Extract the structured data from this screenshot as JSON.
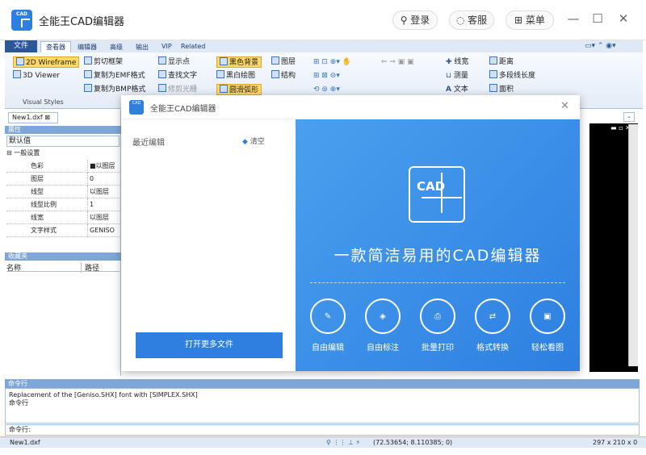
{
  "app": {
    "title": "全能王CAD编辑器",
    "login": "登录",
    "service": "客服",
    "menu": "菜单"
  },
  "ribbon": {
    "tabs": {
      "file": "文件",
      "viewer": "查看器",
      "editor": "编辑器",
      "advanced": "高级",
      "output": "输出",
      "vip": "VIP",
      "related": "Related"
    },
    "wireframe2d": "2D Wireframe",
    "viewer3d": "3D Viewer",
    "visual_styles": "Visual Styles",
    "trim_frame": "剪切框架",
    "copy_emf": "复制为EMF格式",
    "copy_bmp": "复制为BMP格式",
    "show_points": "显示点",
    "find_text": "查找文字",
    "fix_raster": "修剪光栅",
    "black_bg": "黑色背景",
    "bw_draw": "黑白绘图",
    "smooth_arc": "圆滑弧形",
    "layers": "图层",
    "structure": "结构",
    "line_width": "线宽",
    "measure": "测量",
    "text": "文本",
    "distance": "距离",
    "polyline_len": "多段线长度",
    "area": "面积"
  },
  "left": {
    "doc_tab": "New1.dxf",
    "props_header": "属性",
    "default_value": "默认值",
    "general": "一般设置",
    "rows": [
      {
        "k": "色彩",
        "v": "■以图层"
      },
      {
        "k": "图层",
        "v": "0"
      },
      {
        "k": "线型",
        "v": "以图层"
      },
      {
        "k": "线型比例",
        "v": "1"
      },
      {
        "k": "线宽",
        "v": "以图层"
      },
      {
        "k": "文字样式",
        "v": "GENISO"
      }
    ],
    "favorites": "收藏夹",
    "col_name": "名称",
    "col_path": "路径"
  },
  "command": {
    "header": "命令行",
    "line1": "Replacement of the [Geniso.SHX] font with [SIMPLEX.SHX]",
    "line2": "命令行",
    "prompt": "命令行:"
  },
  "status": {
    "file": "New1.dxf",
    "coords": "(72.53654; 8.110385; 0)",
    "size": "297 x 210 x 0"
  },
  "dialog": {
    "title": "全能王CAD编辑器",
    "recent": "最近编辑",
    "clear": "清空",
    "open_more": "打开更多文件",
    "logo_text": "CAD",
    "slogan": "一款简洁易用的CAD编辑器",
    "features": [
      "自由编辑",
      "自由标注",
      "批量打印",
      "格式转换",
      "轻松看图"
    ]
  }
}
